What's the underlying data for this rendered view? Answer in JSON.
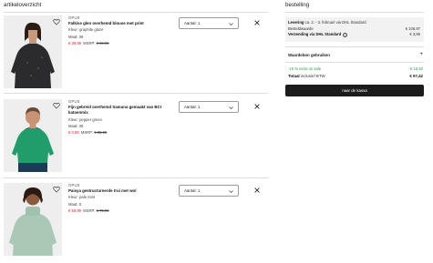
{
  "cart": {
    "title": "artikeloverzicht",
    "items": [
      {
        "brand": "OPUS",
        "name": "Falkise glen overhemd blouse met print",
        "color_text": "Kleur: graphite glaze",
        "size_text": "Maat: 36",
        "price": "€ 39,99",
        "msrp_label": "MSRP:",
        "old_price": "€ 99,99",
        "quantity_label": "Aantal: 1"
      },
      {
        "brand": "OPUS",
        "name": "Fijn gebreid overhemd Samuna gemaakt van BCI katoenmix",
        "color_text": "Kleur: pepper green",
        "size_text": "Maat: 36",
        "price": "€ 0,99",
        "msrp_label": "MSRP:",
        "old_price": "€ 35,99",
        "quantity_label": "Aantal: 1"
      },
      {
        "brand": "OPUS",
        "name": "Paisya gestructureerde trui met wol",
        "color_text": "Kleur: pale mint",
        "size_text": "Maat: S",
        "price": "€ 59,99",
        "msrp_label": "MSRP:",
        "old_price": "€ 79,99",
        "quantity_label": "Aantal: 1"
      }
    ]
  },
  "order": {
    "title": "bestelling",
    "delivery_label": "Levering",
    "delivery_dates": "ca. 2. - 3. februari via DHL Standard",
    "subtotal_label": "Besteldwaarde",
    "subtotal_value": "€ 106,97",
    "shipping_label": "Verzending via DHL Standard",
    "shipping_value": "€ 3,95",
    "voucher_label": "Waardebon gebruiken",
    "discount_label": "-15 % extra on sale",
    "discount_value": "- € 16,50",
    "total_label": "Totaal",
    "total_note": "inclusief BTW",
    "total_value": "€ 97,42",
    "checkout_label": "naar de kassa"
  },
  "colors": {
    "sale_red": "#d2232a",
    "discount_green": "#2e9b4f",
    "cta_black": "#1c1c1c",
    "summary_bg": "#f2f2f2"
  },
  "icons": [
    "heart-icon",
    "chevron-down-icon",
    "close-icon",
    "info-icon",
    "plus-icon"
  ]
}
